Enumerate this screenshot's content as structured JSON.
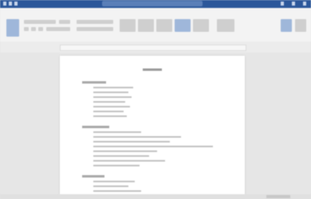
{
  "app": {
    "title": "",
    "accent": "#2b579a"
  },
  "ribbon": {
    "tabs": [
      "",
      "",
      "",
      "",
      "",
      "",
      "",
      ""
    ]
  },
  "document": {
    "title": ""
  }
}
